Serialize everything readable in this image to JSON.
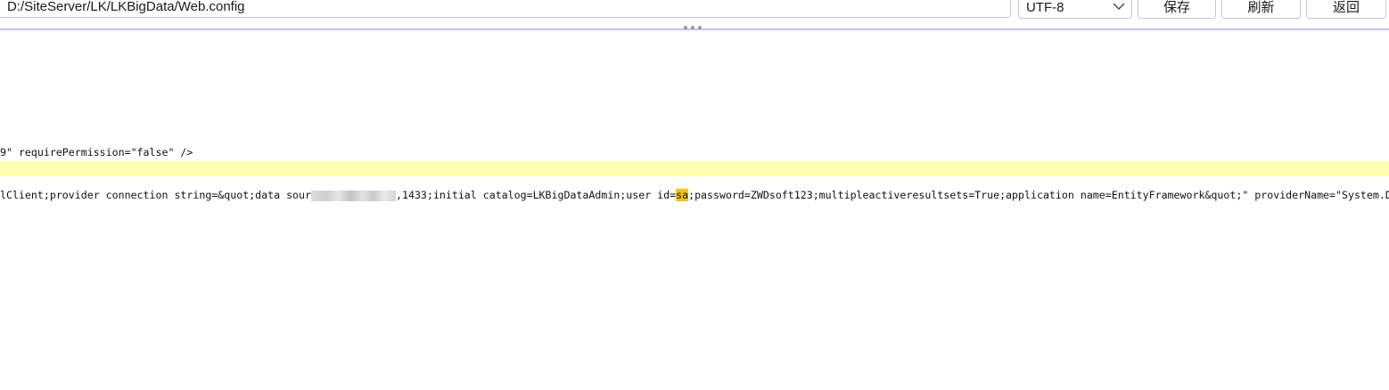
{
  "toolbar": {
    "path_value": "D:/SiteServer/LK/LKBigData/Web.config",
    "encoding": "UTF-8",
    "save_label": "保存",
    "refresh_label": "刷新",
    "back_label": "返回"
  },
  "editor": {
    "line_1": "9\" requirePermission=\"false\" />",
    "line_2": "",
    "line_3_before": "lClient;provider connection string=&quot;data sour",
    "line_3_after_blur": ",1433;initial catalog=LKBigDataAdmin;user id=",
    "line_3_highlight": "sa",
    "line_3_rest": ";password=ZWDsoft123;multipleactiveresultsets=True;application name=EntityFramework&quot;\" providerName=\"System.Data.EntityClient\" />"
  },
  "colors": {
    "current_line": "#ffffb0",
    "search_highlight": "#f5c21b",
    "splitter": "#b9c9dc"
  }
}
